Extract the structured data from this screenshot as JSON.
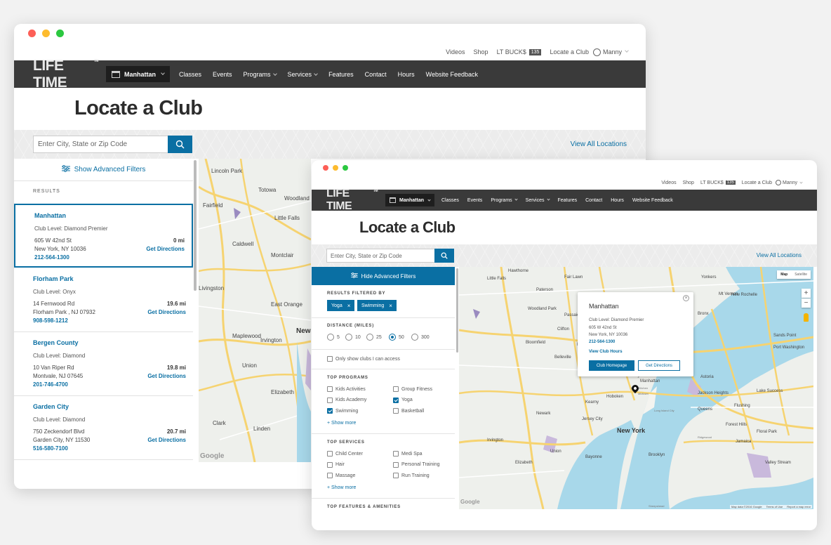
{
  "back": {
    "utility": [
      "Videos",
      "Shop",
      "LT BUCK$"
    ],
    "bucks_badge": "135",
    "locate": "Locate a Club",
    "user": "Manny",
    "logo": "LIFE TIME",
    "club": "Manhattan",
    "nav": [
      {
        "label": "Classes",
        "dropdown": false
      },
      {
        "label": "Events",
        "dropdown": false
      },
      {
        "label": "Programs",
        "dropdown": true
      },
      {
        "label": "Services",
        "dropdown": true
      },
      {
        "label": "Features",
        "dropdown": false
      },
      {
        "label": "Contact",
        "dropdown": false
      },
      {
        "label": "Hours",
        "dropdown": false
      },
      {
        "label": "Website Feedback",
        "dropdown": false
      }
    ],
    "title": "Locate a Club",
    "search_placeholder": "Enter City, State or Zip Code",
    "view_all": "View All Locations",
    "filters_toggle": "Show Advanced Filters",
    "results_heading": "RESULTS",
    "results": [
      {
        "name": "Manhattan",
        "level": "Club Level: Diamond Premier",
        "addr1": "605 W 42nd St",
        "addr2": "New York, NY 10036",
        "phone": "212-564-1300",
        "dist": "0 mi",
        "directions": "Get Directions",
        "selected": true
      },
      {
        "name": "Florham Park",
        "level": "Club Level: Onyx",
        "addr1": "14 Fernwood Rd",
        "addr2": "Florham Park , NJ 07932",
        "phone": "908-598-1212",
        "dist": "19.6 mi",
        "directions": "Get Directions",
        "selected": false
      },
      {
        "name": "Bergen County",
        "level": "Club Level: Diamond",
        "addr1": "10 Van Riper Rd",
        "addr2": "Montvale, NJ 07645",
        "phone": "201-746-4700",
        "dist": "19.8 mi",
        "directions": "Get Directions",
        "selected": false
      },
      {
        "name": "Garden City",
        "level": "Club Level: Diamond",
        "addr1": "750 Zeckendorf Blvd",
        "addr2": "Garden City, NY 11530",
        "phone": "516-580-7100",
        "dist": "20.7 mi",
        "directions": "Get Directions",
        "selected": false
      }
    ],
    "map_labels": [
      "Lincoln Park",
      "Totowa",
      "Woodland Park",
      "Fairfield",
      "Little Falls",
      "Caldwell",
      "Montclair",
      "Livingston",
      "East Orange",
      "Maplewood",
      "Irvington",
      "Union",
      "Newark",
      "Elizabeth",
      "Clark",
      "Linden",
      "Google"
    ]
  },
  "front": {
    "utility": [
      "Videos",
      "Shop",
      "LT BUCK$"
    ],
    "bucks_badge": "135",
    "locate": "Locate a Club",
    "user": "Manny",
    "logo": "LIFE TIME",
    "club": "Manhattan",
    "nav": [
      {
        "label": "Classes",
        "dropdown": false
      },
      {
        "label": "Events",
        "dropdown": false
      },
      {
        "label": "Programs",
        "dropdown": true
      },
      {
        "label": "Services",
        "dropdown": true
      },
      {
        "label": "Features",
        "dropdown": false
      },
      {
        "label": "Contact",
        "dropdown": false
      },
      {
        "label": "Hours",
        "dropdown": false
      },
      {
        "label": "Website Feedback",
        "dropdown": false
      }
    ],
    "title": "Locate a Club",
    "search_placeholder": "Enter City, State or Zip Code",
    "view_all": "View All Locations",
    "filters_toggle": "Hide Advanced Filters",
    "filtered_by_heading": "RESULTS FILTERED BY",
    "tags": [
      "Yoga",
      "Swimming"
    ],
    "distance_heading": "DISTANCE (MILES)",
    "distances": [
      {
        "label": "5",
        "selected": false
      },
      {
        "label": "10",
        "selected": false
      },
      {
        "label": "25",
        "selected": false
      },
      {
        "label": "50",
        "selected": true
      },
      {
        "label": "300",
        "selected": false
      }
    ],
    "access_only": "Only show clubs I can access",
    "programs_heading": "TOP PROGRAMS",
    "programs": [
      {
        "label": "Kids Activities",
        "checked": false
      },
      {
        "label": "Group Fitness",
        "checked": false
      },
      {
        "label": "Kids Academy",
        "checked": false
      },
      {
        "label": "Yoga",
        "checked": true
      },
      {
        "label": "Swimming",
        "checked": true
      },
      {
        "label": "Basketball",
        "checked": false
      }
    ],
    "services_heading": "TOP SERVICES",
    "services": [
      {
        "label": "Child Center",
        "checked": false
      },
      {
        "label": "Medi Spa",
        "checked": false
      },
      {
        "label": "Hair",
        "checked": false
      },
      {
        "label": "Personal Training",
        "checked": false
      },
      {
        "label": "Massage",
        "checked": false
      },
      {
        "label": "Run Training",
        "checked": false
      }
    ],
    "show_more": "+ Show more",
    "features_heading": "TOP FEATURES & AMENITIES",
    "map_type": [
      "Map",
      "Satellite"
    ],
    "popup": {
      "name": "Manhattan",
      "level": "Club Level: Diamond Premier",
      "addr1": "605 W 42nd St",
      "addr2": "New York, NY 10036",
      "phone": "212-564-1300",
      "hours": "View Club Hours",
      "homepage": "Club Homepage",
      "directions": "Get Directions"
    },
    "map_labels": [
      "Hawthorne",
      "Fair Lawn",
      "Paterson",
      "Clifton",
      "Little Falls",
      "Woodland Park",
      "Passaic",
      "Nutley",
      "Belleville",
      "Bloomfield",
      "Newark",
      "Kearny",
      "Jersey City",
      "Hoboken",
      "Union City",
      "Bayonne",
      "Elizabeth",
      "Union",
      "Irvington",
      "New York",
      "Brooklyn",
      "Queens",
      "Manhattan",
      "Mt Vernon",
      "New Rochelle",
      "Yonkers",
      "Sands Point",
      "Port Washington",
      "Lake Success",
      "Floral Park",
      "Valley Stream",
      "Jamaica",
      "Forest Hills",
      "Flushing",
      "Jackson Heights",
      "Long Island City",
      "Astoria",
      "Ridgewood",
      "Bronx",
      "Sheepshead",
      "Midtown",
      "Hell's Kitchen",
      "Google"
    ],
    "map_attribution": [
      "Map data ©2016 Google",
      "Terms of Use",
      "Report a map error"
    ]
  },
  "colors": {
    "brand_blue": "#0a6fa3",
    "navbar": "#3a3a3a",
    "club_select": "#1e1e1e"
  }
}
